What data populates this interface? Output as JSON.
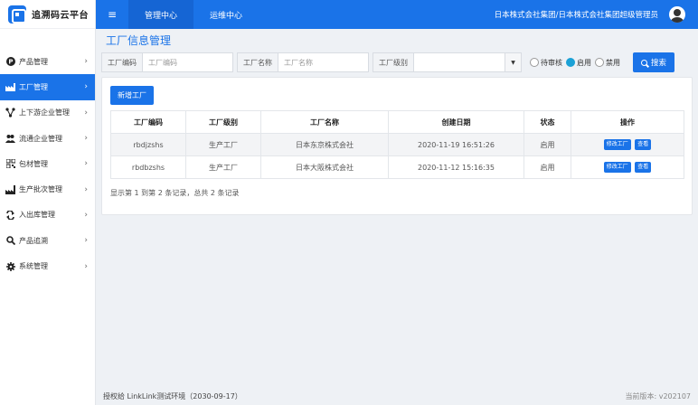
{
  "app": {
    "title": "追溯码云平台"
  },
  "topbar": {
    "menu_icon": "hamburger-icon",
    "tabs": [
      {
        "label": "管理中心",
        "active": true
      },
      {
        "label": "运维中心",
        "active": false
      }
    ],
    "user": "日本株式会社集团/日本株式会社集团超级管理员"
  },
  "sidebar": {
    "items": [
      {
        "label": "产品管理",
        "icon": "product-icon",
        "active": false
      },
      {
        "label": "工厂管理",
        "icon": "factory-icon",
        "active": true
      },
      {
        "label": "上下游企业管理",
        "icon": "supply-chain-icon",
        "active": false
      },
      {
        "label": "流通企业管理",
        "icon": "users-icon",
        "active": false
      },
      {
        "label": "包材管理",
        "icon": "qrcode-icon",
        "active": false
      },
      {
        "label": "生产批次管理",
        "icon": "batch-icon",
        "active": false
      },
      {
        "label": "入出库管理",
        "icon": "exchange-icon",
        "active": false
      },
      {
        "label": "产品追溯",
        "icon": "search-icon",
        "active": false
      },
      {
        "label": "系统管理",
        "icon": "gear-icon",
        "active": false
      }
    ]
  },
  "page": {
    "title": "工厂信息管理"
  },
  "filters": {
    "code_label": "工厂编码",
    "code_placeholder": "工厂编码",
    "name_label": "工厂名称",
    "name_placeholder": "工厂名称",
    "level_label": "工厂级别",
    "level_value": "",
    "status_options": [
      {
        "label": "待审核",
        "checked": false
      },
      {
        "label": "启用",
        "checked": true
      },
      {
        "label": "禁用",
        "checked": false
      }
    ],
    "search_label": "搜索"
  },
  "table": {
    "add_label": "新增工厂",
    "headers": [
      "工厂编码",
      "工厂级别",
      "工厂名称",
      "创建日期",
      "状态",
      "操作"
    ],
    "rows": [
      {
        "code": "rbdjzshs",
        "level": "生产工厂",
        "name": "日本东京株式会社",
        "date": "2020-11-19 16:51:26",
        "status": "启用",
        "edit": "修改工厂",
        "view": "查看"
      },
      {
        "code": "rbdbzshs",
        "level": "生产工厂",
        "name": "日本大阪株式会社",
        "date": "2020-11-12 15:16:35",
        "status": "启用",
        "edit": "修改工厂",
        "view": "查看"
      }
    ],
    "summary": "显示第 1 到第 2 条记录，总共 2 条记录"
  },
  "footer": {
    "license": "授权给 LinkLink测试环境（2030-09-17）",
    "version": "当前版本: v202107"
  },
  "colors": {
    "primary": "#1a73e8",
    "radio_on": "#1ba1d6"
  }
}
